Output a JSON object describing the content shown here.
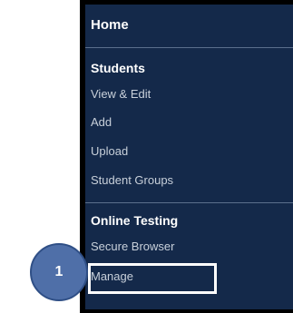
{
  "nav": {
    "home": "Home",
    "students": {
      "title": "Students",
      "items": [
        "View & Edit",
        "Add",
        "Upload",
        "Student Groups"
      ]
    },
    "online_testing": {
      "title": "Online Testing",
      "items": [
        "Secure Browser",
        "Manage"
      ]
    }
  },
  "callout": {
    "step": "1"
  },
  "colors": {
    "panel_background": "#14294a",
    "panel_border": "#000000",
    "link_text": "#c8d0da",
    "heading_text": "#ffffff",
    "callout_fill": "#4f6fa8",
    "highlight_border": "#ffffff"
  }
}
